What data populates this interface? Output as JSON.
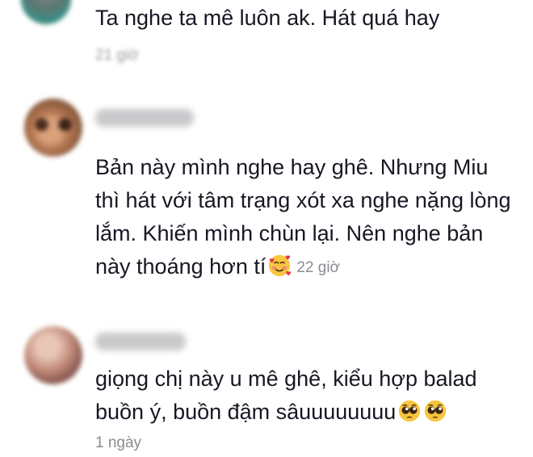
{
  "comments": [
    {
      "text": "Ta nghe ta mê luôn ak. Hát quá hay",
      "time": "21 giờ"
    },
    {
      "text": "Bản này mình nghe hay ghê. Nhưng Miu thì hát với tâm trạng xót xa nghe nặng lòng lắm. Khiến mình chùn lại. Nên nghe bản này thoáng hơn tí",
      "time": "22 giờ",
      "emoji": "smiling-face-with-hearts-icon"
    },
    {
      "text": "giọng chị này u mê ghê, kiểu hợp balad buồn ý, buồn đậm sâuuuuuuuu",
      "time": "1 ngày",
      "emoji": "pleading-face-icon"
    }
  ],
  "colors": {
    "text": "#161823",
    "muted": "#8a8b91",
    "background": "#ffffff"
  }
}
